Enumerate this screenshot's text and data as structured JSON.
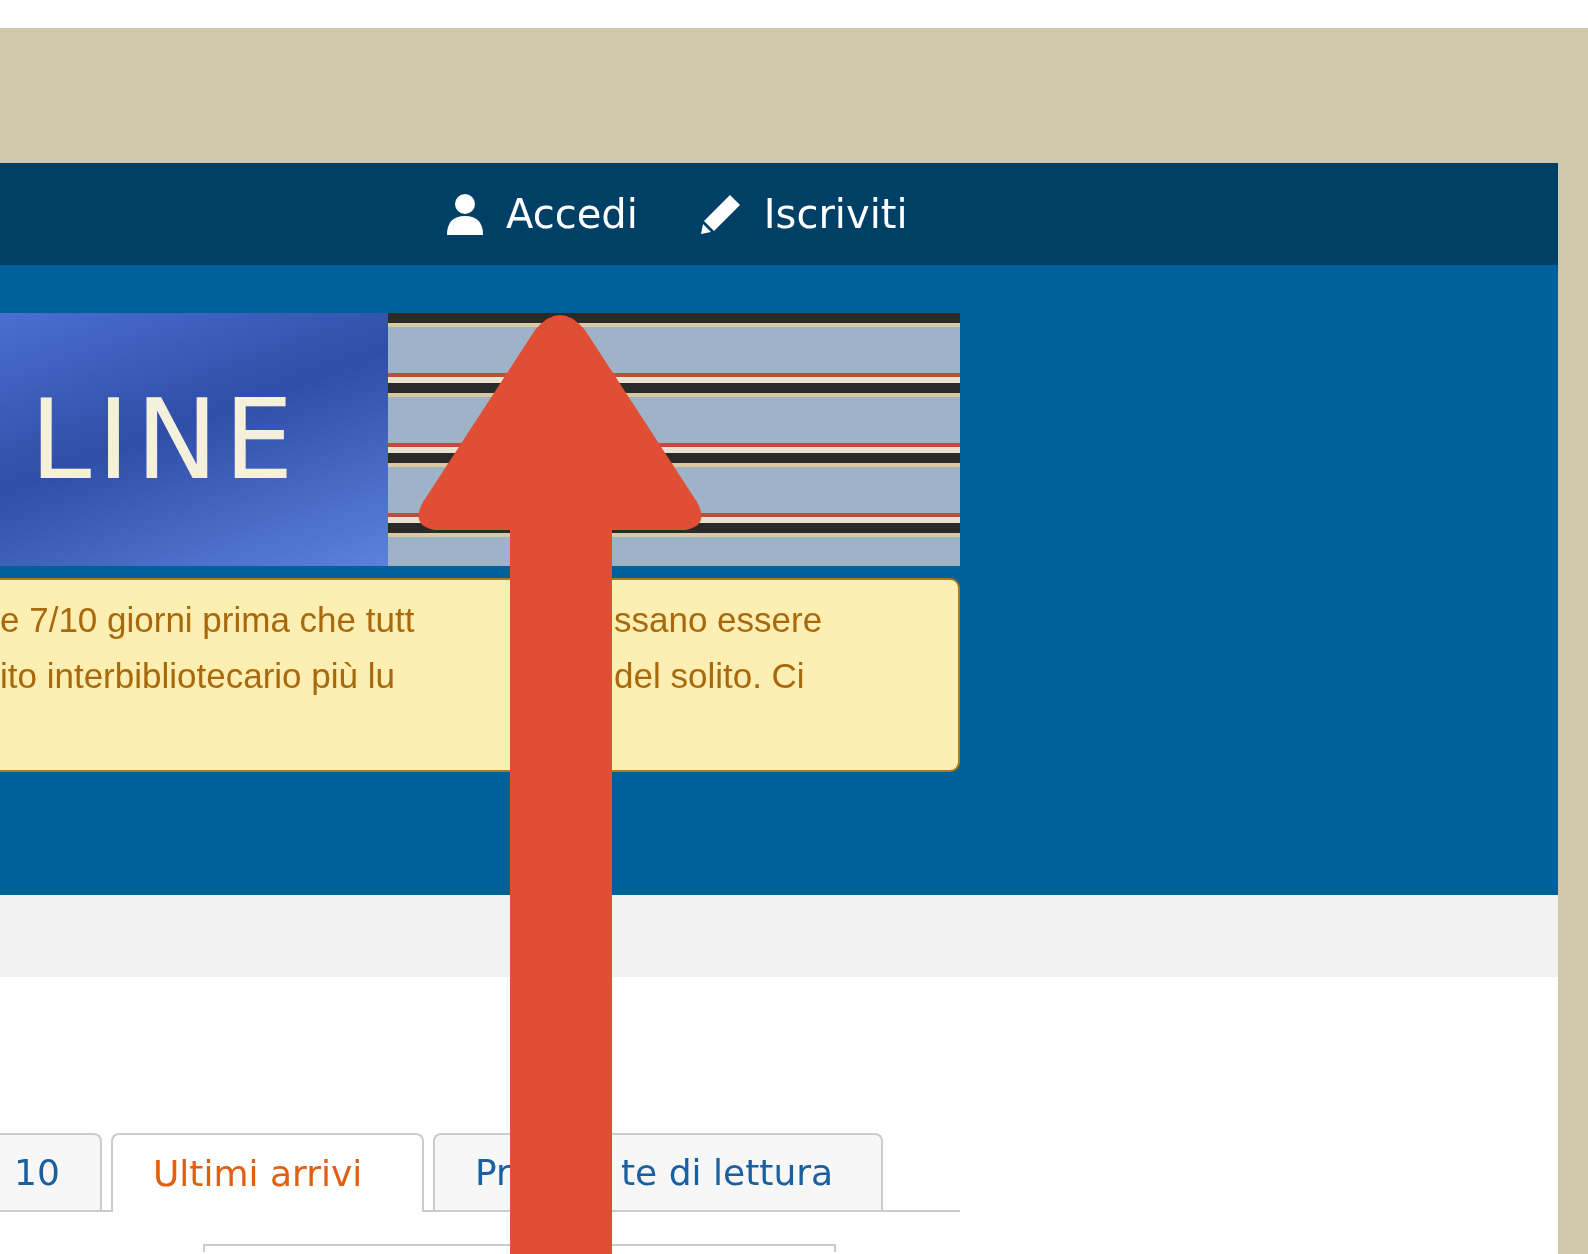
{
  "nav": [
    {
      "kind": "login",
      "label": "Accedi"
    },
    {
      "kind": "signup",
      "label": "Iscriviti"
    }
  ],
  "banner": {
    "logo_text": "LINE"
  },
  "notice": {
    "lines": [
      [
        "e 7/10 giorni prima che tutt",
        "ssano essere"
      ],
      [
        "ito interbibliotecario più lu",
        "del solito. Ci"
      ]
    ]
  },
  "tabs": [
    {
      "parts": [
        "10"
      ],
      "selected": false
    },
    {
      "parts": [
        "Ultimi arrivi"
      ],
      "selected": true
    },
    {
      "parts": [
        "Pr",
        "te di lettura"
      ],
      "selected": false
    }
  ],
  "annotation": {
    "kind": "arrow-up"
  }
}
